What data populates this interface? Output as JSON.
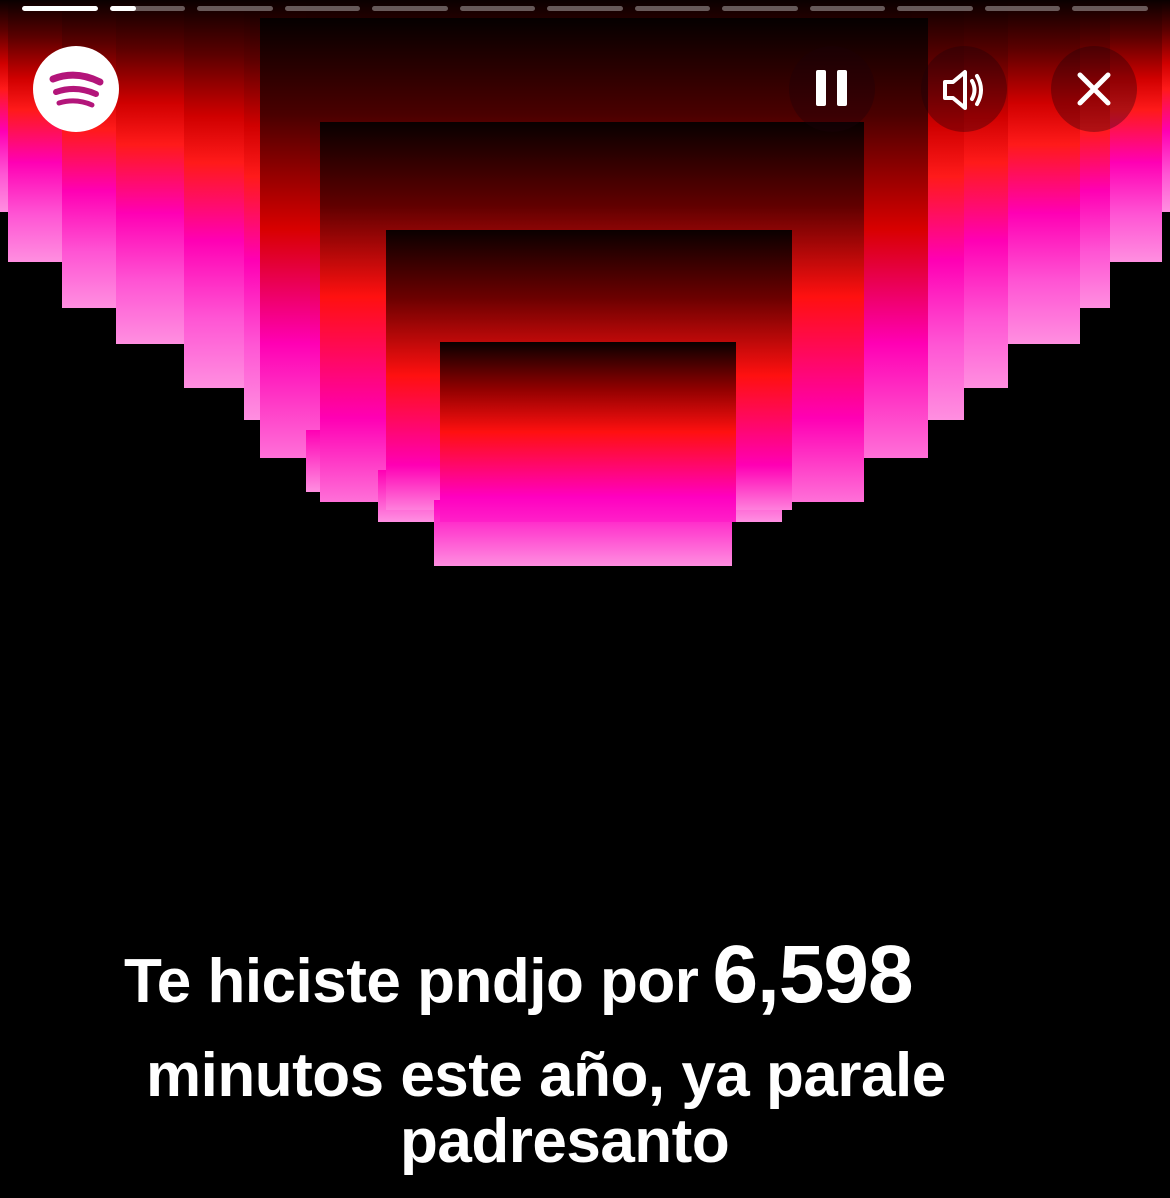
{
  "story": {
    "segments_total": 13,
    "current_segment": 2,
    "current_segment_progress": 0.35
  },
  "logo": {
    "icon": "spotify-logo-icon",
    "color": "#b3157a"
  },
  "controls": {
    "pause": {
      "icon": "pause-icon"
    },
    "sound": {
      "icon": "speaker-icon"
    },
    "close": {
      "icon": "close-icon"
    }
  },
  "caption": {
    "line1_text": "Te hiciste pndjo por",
    "minutes": "6,598",
    "line2_text": "minutos este año, ya parale",
    "line3_text": "padresanto"
  },
  "colors": {
    "background": "#000000",
    "accent_red": "#ff1a1a",
    "accent_pink": "#ff00b4",
    "text": "#ffffff"
  }
}
